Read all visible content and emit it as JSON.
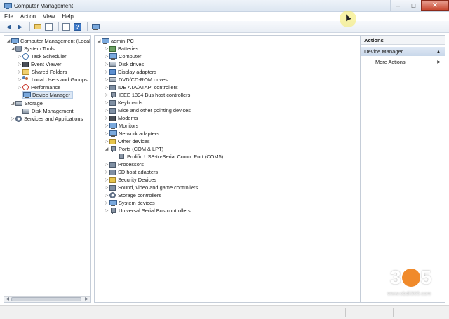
{
  "window": {
    "title": "Computer Management",
    "controls": {
      "minimize": "–",
      "maximize": "□",
      "close": "✕"
    }
  },
  "menubar": {
    "items": [
      "File",
      "Action",
      "View",
      "Help"
    ]
  },
  "toolbar": {
    "icons": [
      "back-icon",
      "forward-icon",
      "up-folder-icon",
      "show-hide-tree-icon",
      "properties-icon",
      "help-icon",
      "device-scan-icon"
    ],
    "help_glyph": "?"
  },
  "left_tree": {
    "root": "Computer Management (Local",
    "system_tools": "System Tools",
    "task_scheduler": "Task Scheduler",
    "event_viewer": "Event Viewer",
    "shared_folders": "Shared Folders",
    "local_users": "Local Users and Groups",
    "performance": "Performance",
    "device_manager": "Device Manager",
    "storage": "Storage",
    "disk_management": "Disk Management",
    "services": "Services and Applications"
  },
  "device_tree": {
    "root": "admin-PC",
    "categories": [
      "Batteries",
      "Computer",
      "Disk drives",
      "Display adapters",
      "DVD/CD-ROM drives",
      "IDE ATA/ATAPI controllers",
      "IEEE 1394 Bus host controllers",
      "Keyboards",
      "Mice and other pointing devices",
      "Modems",
      "Monitors",
      "Network adapters",
      "Other devices",
      "Ports (COM & LPT)",
      "Prolific USB-to-Serial Comm Port (COM5)",
      "Processors",
      "SD host adapters",
      "Security Devices",
      "Sound, video and game controllers",
      "Storage controllers",
      "System devices",
      "Universal Serial Bus controllers"
    ]
  },
  "actions_pane": {
    "header": "Actions",
    "selected": "Device Manager",
    "more": "More Actions"
  },
  "watermark": {
    "digit1": "3",
    "digit2": "5",
    "url": "www.obdii365.com",
    "accent": "#f08a2b"
  }
}
